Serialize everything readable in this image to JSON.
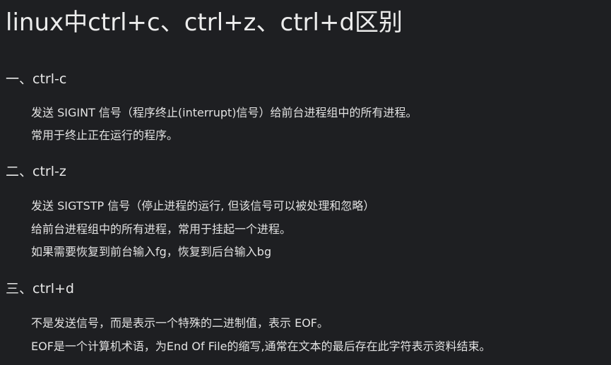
{
  "title": "linux中ctrl+c、ctrl+z、ctrl+d区别",
  "sections": [
    {
      "heading": "一、ctrl-c",
      "lines": [
        "发送 SIGINT 信号（程序终止(interrupt)信号）给前台进程组中的所有进程。",
        "常用于终止正在运行的程序。"
      ]
    },
    {
      "heading": "二、ctrl-z",
      "lines": [
        "发送 SIGTSTP 信号（停止进程的运行, 但该信号可以被处理和忽略）",
        "给前台进程组中的所有进程，常用于挂起一个进程。",
        "如果需要恢复到前台输入fg，恢复到后台输入bg"
      ]
    },
    {
      "heading": "三、ctrl+d",
      "lines": [
        "不是发送信号，而是表示一个特殊的二进制值，表示 EOF。",
        "EOF是一个计算机术语，为End Of File的缩写,通常在文本的最后存在此字符表示资料结束。"
      ]
    }
  ],
  "colors": {
    "background": "#1e1f22",
    "text": "#e6e6e6"
  }
}
